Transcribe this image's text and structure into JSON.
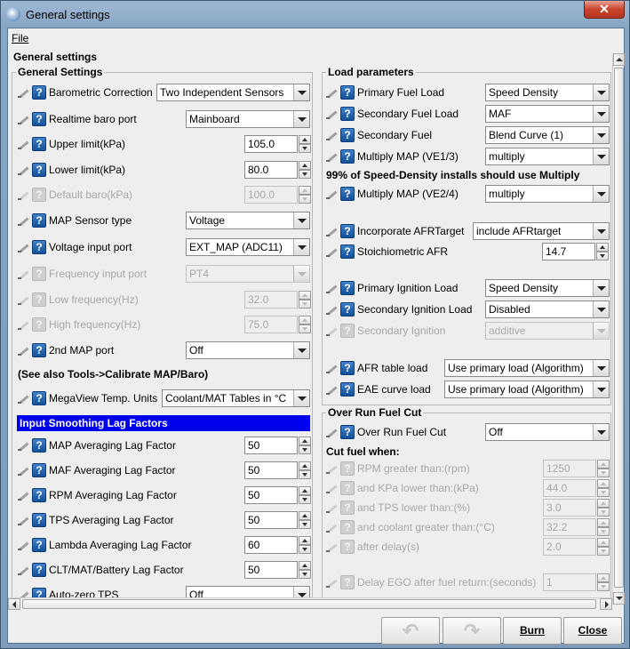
{
  "window": {
    "title": "General settings",
    "close_label": "✕"
  },
  "menu": {
    "file": "File"
  },
  "outer_title": "General settings",
  "left": {
    "title": "General Settings",
    "rows": [
      {
        "label": "Barometric Correction",
        "kind": "combo",
        "value": "Two Independent Sensors",
        "disabled": false
      },
      {
        "label": "Realtime baro port",
        "kind": "combo",
        "value": "Mainboard",
        "disabled": false
      },
      {
        "label": "Upper limit(kPa)",
        "kind": "spin",
        "value": "105.0",
        "disabled": false
      },
      {
        "label": "Lower limit(kPa)",
        "kind": "spin",
        "value": "80.0",
        "disabled": false
      },
      {
        "label": "Default baro(kPa)",
        "kind": "spin",
        "value": "100.0",
        "disabled": true
      },
      {
        "label": "MAP Sensor type",
        "kind": "combo",
        "value": "Voltage",
        "disabled": false
      },
      {
        "label": "Voltage input port",
        "kind": "combo",
        "value": "EXT_MAP (ADC11)",
        "disabled": false
      },
      {
        "label": "Frequency input port",
        "kind": "combo",
        "value": "PT4",
        "disabled": true
      },
      {
        "label": "Low frequency(Hz)",
        "kind": "spin",
        "value": "32.0",
        "disabled": true
      },
      {
        "label": "High frequency(Hz)",
        "kind": "spin",
        "value": "75.0",
        "disabled": true
      },
      {
        "label": "2nd MAP port",
        "kind": "combo",
        "value": "Off",
        "disabled": false
      }
    ],
    "note": "(See also Tools->Calibrate MAP/Baro)",
    "megaview": {
      "label": "MegaView Temp. Units",
      "value": "Coolant/MAT Tables in °C"
    },
    "smoothing_header": "Input Smoothing Lag Factors",
    "lag_rows": [
      {
        "label": "MAP Averaging Lag Factor",
        "value": "50"
      },
      {
        "label": "MAF Averaging Lag Factor",
        "value": "50"
      },
      {
        "label": "RPM Averaging Lag Factor",
        "value": "50"
      },
      {
        "label": "TPS Averaging Lag Factor",
        "value": "50"
      },
      {
        "label": "Lambda Averaging Lag Factor",
        "value": "60"
      },
      {
        "label": "CLT/MAT/Battery Lag Factor",
        "value": "50"
      }
    ],
    "autozero": {
      "label": "Auto-zero TPS",
      "value": "Off"
    }
  },
  "load": {
    "title": "Load parameters",
    "rows": [
      {
        "label": "Primary Fuel Load",
        "value": "Speed Density"
      },
      {
        "label": "Secondary Fuel Load",
        "value": "MAF"
      },
      {
        "label": "Secondary Fuel",
        "value": "Blend Curve (1)"
      },
      {
        "label": "Multiply MAP (VE1/3)",
        "value": "multiply"
      }
    ],
    "note": "99% of Speed-Density installs should use Multiply",
    "multiply24": {
      "label": "Multiply MAP (VE2/4)",
      "value": "multiply"
    },
    "afr_target": {
      "label": "Incorporate AFRTarget",
      "value": "include AFRtarget"
    },
    "stoich": {
      "label": "Stoichiometric AFR",
      "value": "14.7"
    },
    "ign_rows": [
      {
        "label": "Primary Ignition Load",
        "value": "Speed Density",
        "disabled": false
      },
      {
        "label": "Secondary Ignition Load",
        "value": "Disabled",
        "disabled": false
      },
      {
        "label": "Secondary Ignition",
        "value": "additive",
        "disabled": true
      }
    ],
    "afr_table": {
      "label": "AFR table load",
      "value": "Use primary load (Algorithm)"
    },
    "eae_curve": {
      "label": "EAE curve load",
      "value": "Use primary load (Algorithm)"
    }
  },
  "overrun": {
    "title": "Over Run Fuel Cut",
    "main": {
      "label": "Over Run Fuel Cut",
      "value": "Off"
    },
    "cut_when": "Cut fuel when:",
    "rows": [
      {
        "label": "RPM greater than:(rpm)",
        "value": "1250"
      },
      {
        "label": "and KPa lower than:(kPa)",
        "value": "44.0"
      },
      {
        "label": "and TPS lower than:(%)",
        "value": "3.0"
      },
      {
        "label": "and coolant greater than:(°C)",
        "value": "32.2"
      },
      {
        "label": "after delay(s)",
        "value": "2.0"
      }
    ],
    "delay_ego": {
      "label": "Delay EGO after fuel return:(seconds)",
      "value": "1"
    }
  },
  "buttons": {
    "burn": "Burn",
    "close": "Close"
  }
}
